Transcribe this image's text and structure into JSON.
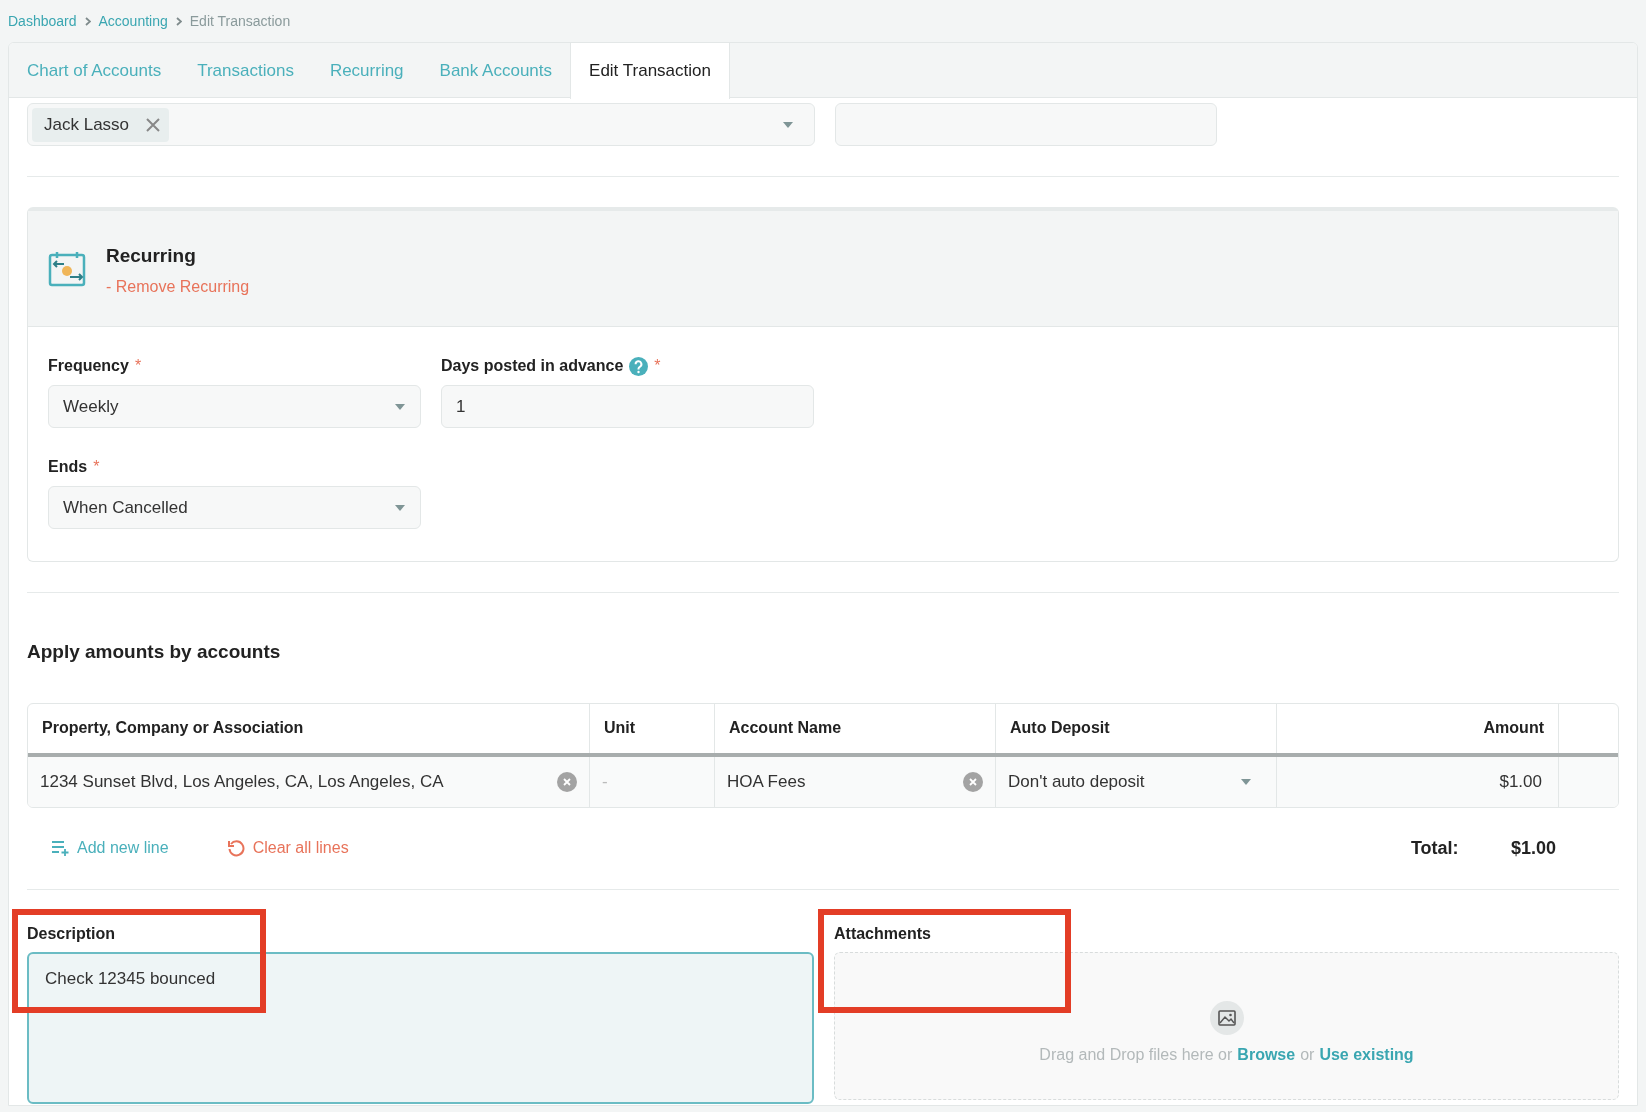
{
  "breadcrumb": [
    {
      "label": "Dashboard",
      "kind": "link"
    },
    {
      "label": "Accounting",
      "kind": "link"
    },
    {
      "label": "Edit Transaction",
      "kind": "current"
    }
  ],
  "tabs": [
    {
      "label": "Chart of Accounts",
      "selected": false
    },
    {
      "label": "Transactions",
      "selected": false
    },
    {
      "label": "Recurring",
      "selected": false
    },
    {
      "label": "Bank Accounts",
      "selected": false
    },
    {
      "label": "Edit Transaction",
      "selected": true
    }
  ],
  "payee_field": {
    "tags": [
      "Jack Lasso"
    ]
  },
  "recurring": {
    "title": "Recurring",
    "remove_link": "- Remove Recurring",
    "fields": [
      {
        "label": "Frequency",
        "required_mark": "*",
        "kind": "select",
        "value": "Weekly",
        "help": false
      },
      {
        "label": "Days posted in advance",
        "required_mark": "*",
        "kind": "input",
        "value": "1",
        "help": true
      },
      {
        "label": "Ends",
        "required_mark": "*",
        "kind": "select",
        "value": "When Cancelled",
        "help": false
      }
    ]
  },
  "section_title": "Apply amounts by accounts",
  "table": {
    "columns": [
      "Property, Company or Association",
      "Unit",
      "Account Name",
      "Auto Deposit",
      "Amount"
    ],
    "rows": [
      [
        {
          "kind": "clearable",
          "text": "1234 Sunset Blvd, Los Angeles, CA, Los Angeles, CA"
        },
        {
          "kind": "muted",
          "text": "-"
        },
        {
          "kind": "clearable",
          "text": "HOA Fees"
        },
        {
          "kind": "select",
          "text": "Don't auto deposit"
        },
        {
          "kind": "amount",
          "text": "$1.00"
        }
      ]
    ]
  },
  "actions": [
    {
      "kind": "add",
      "label": "Add new line"
    },
    {
      "kind": "clear",
      "label": "Clear all lines"
    }
  ],
  "total": {
    "label": "Total:",
    "value": "$1.00"
  },
  "description": {
    "label": "Description",
    "value": "Check 12345 bounced"
  },
  "attachments": {
    "label": "Attachments",
    "hint": [
      {
        "kind": "text",
        "text": "Drag and Drop files here or"
      },
      {
        "kind": "link",
        "text": "Browse"
      },
      {
        "kind": "text",
        "text": "or"
      },
      {
        "kind": "link",
        "text": "Use existing"
      }
    ]
  }
}
